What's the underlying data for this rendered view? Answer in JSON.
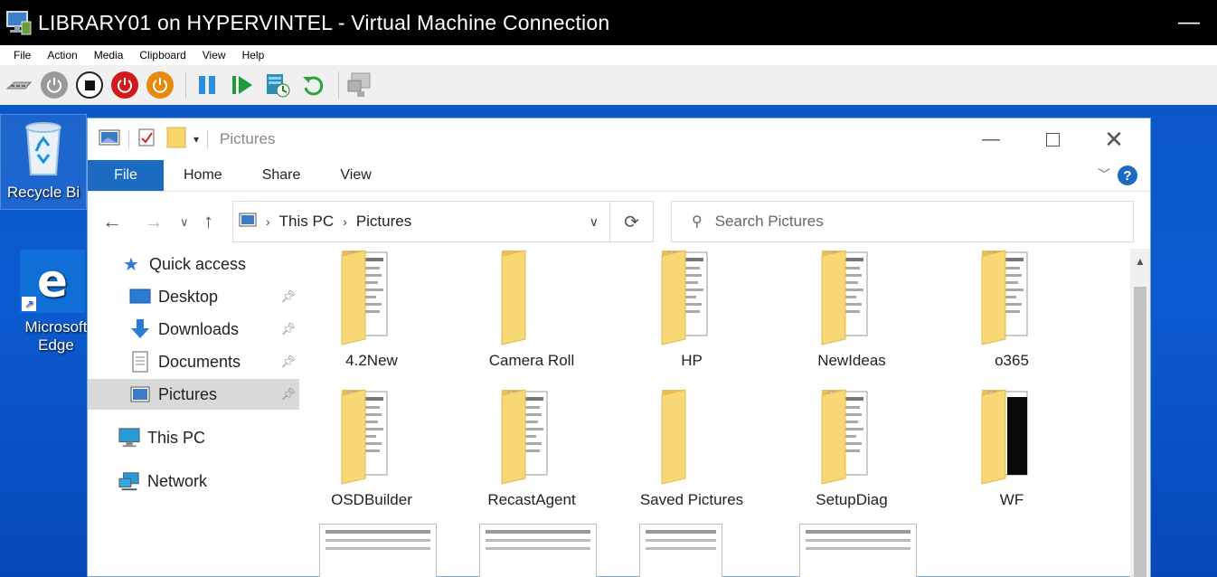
{
  "host": {
    "title": "LIBRARY01 on HYPERVINTEL - Virtual Machine Connection",
    "menu": [
      "File",
      "Action",
      "Media",
      "Clipboard",
      "View",
      "Help"
    ],
    "toolbar_icons": [
      "ctrl-alt-del-icon",
      "start-icon",
      "turn-off-icon",
      "shut-down-icon",
      "save-icon",
      "pause-icon",
      "resume-icon",
      "checkpoint-icon",
      "revert-icon",
      "enhanced-session-icon"
    ]
  },
  "desktop": {
    "icons": [
      {
        "label": "Recycle Bin",
        "visible_text": "Recycle Bi"
      },
      {
        "label": "Microsoft Edge",
        "line1": "Microsoft",
        "line2": "Edge"
      }
    ]
  },
  "explorer": {
    "title": "Pictures",
    "ribbon": {
      "file": "File",
      "tabs": [
        "Home",
        "Share",
        "View"
      ],
      "help": "?"
    },
    "address": {
      "crumbs": [
        "This PC",
        "Pictures"
      ]
    },
    "search": {
      "placeholder": "Search Pictures"
    },
    "nav": {
      "quick_access": "Quick access",
      "items": [
        "Desktop",
        "Downloads",
        "Documents",
        "Pictures"
      ],
      "this_pc": "This PC",
      "network": "Network"
    },
    "folders": [
      {
        "name": "4.2New",
        "style": "doc"
      },
      {
        "name": "Camera Roll",
        "style": "empty"
      },
      {
        "name": "HP",
        "style": "doc"
      },
      {
        "name": "NewIdeas",
        "style": "doc"
      },
      {
        "name": "o365",
        "style": "doc"
      },
      {
        "name": "OSDBuilder",
        "style": "doc"
      },
      {
        "name": "RecastAgent",
        "style": "doc"
      },
      {
        "name": "Saved Pictures",
        "style": "empty"
      },
      {
        "name": "SetupDiag",
        "style": "doc"
      },
      {
        "name": "WF",
        "style": "dark"
      }
    ]
  }
}
